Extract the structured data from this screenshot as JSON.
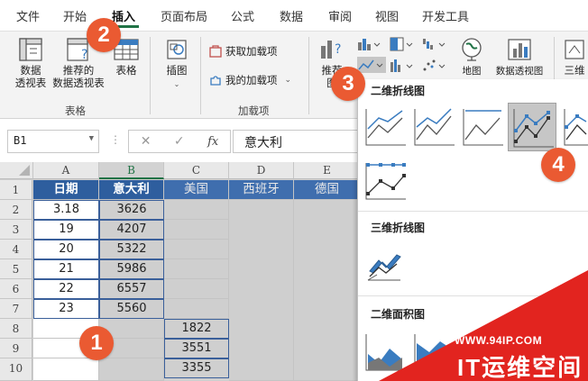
{
  "ribbon_tabs": [
    "文件",
    "开始",
    "插入",
    "页面布局",
    "公式",
    "数据",
    "审阅",
    "视图",
    "开发工具"
  ],
  "active_tab": "插入",
  "ribbon": {
    "pivot_table": "数据\n透视表",
    "pivot_table_l1": "数据",
    "pivot_table_l2": "透视表",
    "recommended_pivot_l1": "推荐的",
    "recommended_pivot_l2": "数据透视表",
    "table": "表格",
    "group_tables": "表格",
    "illustrations": "插图",
    "get_addins": "获取加载项",
    "my_addins": "我的加载项",
    "group_addins": "加载项",
    "recommended_chart_partial": "推荐",
    "recommended_chart_partial2": "图",
    "map": "地图",
    "pivot_chart": "数据透视图",
    "three_d": "三维"
  },
  "formula_bar": {
    "name_box": "B1",
    "cancel_glyph": "✕",
    "enter_glyph": "✓",
    "fx_glyph": "fx",
    "value": "意大利"
  },
  "grid": {
    "columns": [
      "A",
      "B",
      "C",
      "D",
      "E"
    ],
    "rows": [
      "1",
      "2",
      "3",
      "4",
      "5",
      "6",
      "7",
      "8",
      "9",
      "10"
    ],
    "header_row": [
      "日期",
      "意大利",
      "美国",
      "西班牙",
      "德国"
    ],
    "col_a": [
      "3.18",
      "19",
      "20",
      "21",
      "22",
      "23"
    ],
    "col_b": [
      "3626",
      "4207",
      "5322",
      "5986",
      "6557",
      "5560"
    ],
    "col_c": [
      "1822",
      "3551",
      "3355"
    ]
  },
  "gallery": {
    "section_2d_line": "二维折线图",
    "section_3d_line": "三维折线图",
    "section_2d_area": "二维面积图",
    "accent": "#217346",
    "line_color": "#3a7cc0"
  },
  "badges": [
    "1",
    "2",
    "3",
    "4"
  ],
  "watermark": {
    "url": "WWW.94IP.COM",
    "name": "IT运维空间"
  }
}
